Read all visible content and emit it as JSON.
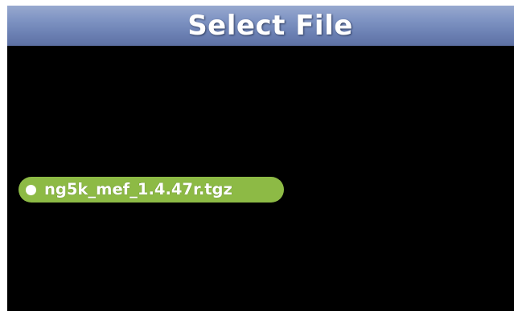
{
  "header": {
    "title": "Select File"
  },
  "file_list": {
    "items": [
      {
        "name": "ng5k_mef_1.4.47r.tgz",
        "selected": true
      }
    ]
  },
  "colors": {
    "title_bar": "#7f94c3",
    "background": "#000000",
    "selected_item": "#8dba45",
    "text": "#ffffff"
  },
  "icons": {
    "item_marker": "radio-dot-icon"
  }
}
